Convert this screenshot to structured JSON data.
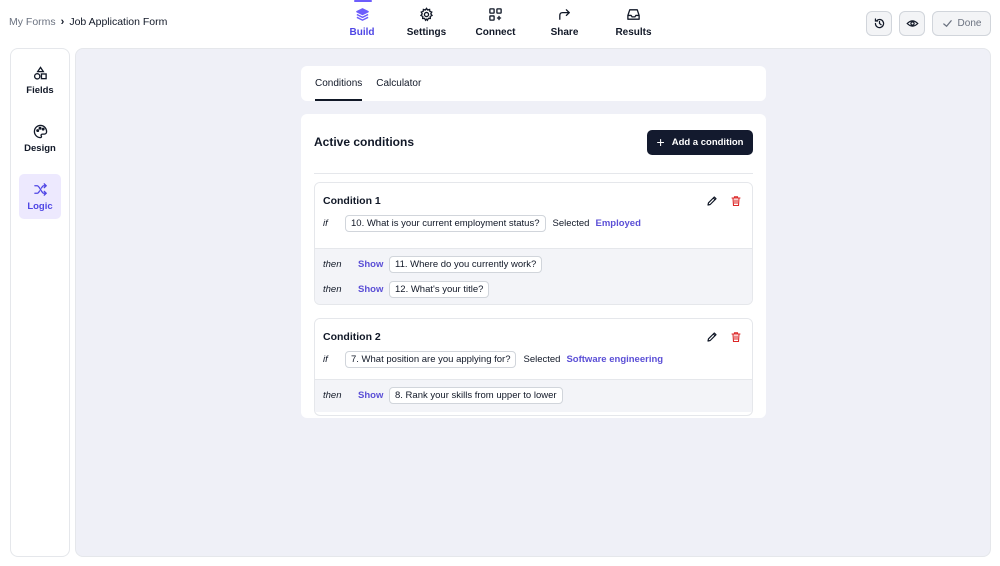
{
  "breadcrumb": {
    "parent": "My Forms",
    "separator": "›",
    "current": "Job Application Form"
  },
  "nav": [
    {
      "label": "Build",
      "icon": "layers-icon",
      "active": true
    },
    {
      "label": "Settings",
      "icon": "gear-icon",
      "active": false
    },
    {
      "label": "Connect",
      "icon": "connect-icon",
      "active": false
    },
    {
      "label": "Share",
      "icon": "share-arrow-icon",
      "active": false
    },
    {
      "label": "Results",
      "icon": "inbox-icon",
      "active": false
    }
  ],
  "actions": {
    "done_label": "Done"
  },
  "sidebar": [
    {
      "label": "Fields",
      "icon": "shapes-icon"
    },
    {
      "label": "Design",
      "icon": "palette-icon"
    },
    {
      "label": "Logic",
      "icon": "shuffle-icon",
      "active": true
    }
  ],
  "tabs": [
    {
      "label": "Conditions",
      "active": true
    },
    {
      "label": "Calculator",
      "active": false
    }
  ],
  "panel": {
    "title": "Active conditions",
    "add_label": "Add a condition"
  },
  "conditions": [
    {
      "name": "Condition 1",
      "if_kw": "if",
      "question": "10. What is your current employment status?",
      "selected": "Selected",
      "answer": "Employed",
      "then": [
        {
          "kw": "then",
          "action": "Show",
          "target": "11. Where do you currently work?"
        },
        {
          "kw": "then",
          "action": "Show",
          "target": "12. What's your title?"
        }
      ]
    },
    {
      "name": "Condition 2",
      "if_kw": "if",
      "question": "7. What position are you applying for?",
      "selected": "Selected",
      "answer": "Software engineering",
      "then": [
        {
          "kw": "then",
          "action": "Show",
          "target": "8. Rank your skills from upper to lower"
        }
      ]
    }
  ],
  "colors": {
    "accent": "#5b4fd6",
    "button_dark": "#131a2e",
    "canvas_bg": "#eff0f7",
    "delete": "#dc2626"
  }
}
